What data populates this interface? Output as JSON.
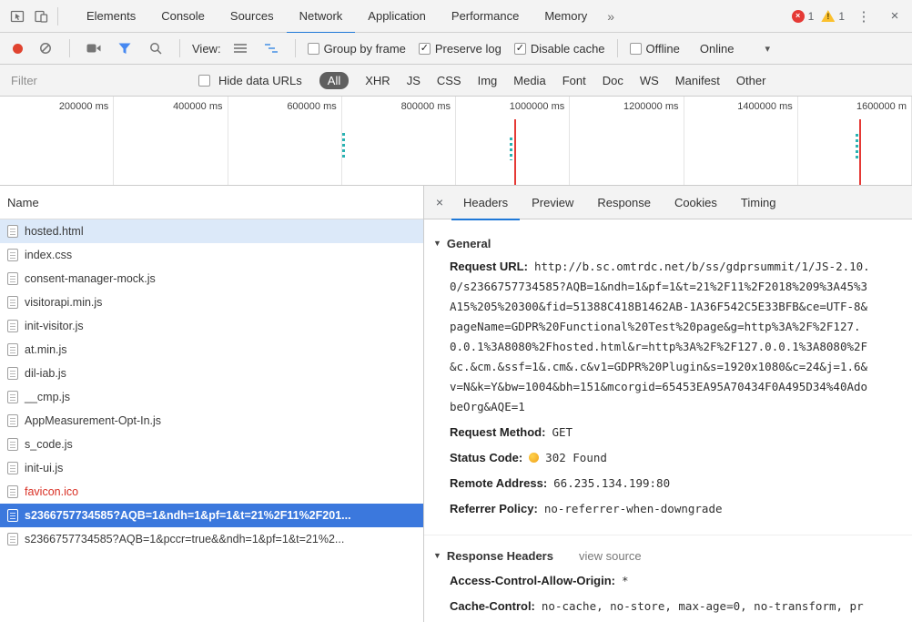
{
  "colors": {
    "tab_underline": "#1e78d7",
    "selection_blue": "#3b78dd",
    "row_highlight": "#dce9f9",
    "error_red": "#d93025",
    "error_badge_red": "#e53935",
    "warning_yellow": "#fbc02d",
    "record_red": "#e0432f",
    "funnel_blue": "#4688f1",
    "status_dot_yellow": "#f0a019",
    "timeline_line_red": "#e53935",
    "timeline_dot_teal": "#2bb3b3",
    "all_pill_bg": "#5f5f5f"
  },
  "icons": {
    "close": "×",
    "overflow_menu": "⋮",
    "more_tabs": "»",
    "dropdown_caret": "▾",
    "section_caret_open": "▼",
    "checkmark": "✓",
    "error_badge": "×",
    "warning_badge": "!"
  },
  "top_bar": {
    "tabs": [
      "Elements",
      "Console",
      "Sources",
      "Network",
      "Application",
      "Performance",
      "Memory"
    ],
    "active_tab": "Network",
    "error_count": "1",
    "warning_count": "1"
  },
  "toolbar": {
    "view_label": "View:",
    "options": [
      {
        "label": "Group by frame",
        "checked": false
      },
      {
        "label": "Preserve log",
        "checked": true
      },
      {
        "label": "Disable cache",
        "checked": true
      },
      {
        "label": "Offline",
        "checked": false
      }
    ],
    "throttling_value": "Online"
  },
  "filter_bar": {
    "filter_placeholder": "Filter",
    "hide_data_urls_label": "Hide data URLs",
    "types": [
      "All",
      "XHR",
      "JS",
      "CSS",
      "Img",
      "Media",
      "Font",
      "Doc",
      "WS",
      "Manifest",
      "Other"
    ],
    "active_type": "All"
  },
  "timeline": {
    "tick_labels": [
      "200000 ms",
      "400000 ms",
      "600000 ms",
      "800000 ms",
      "1000000 ms",
      "1200000 ms",
      "1400000 ms",
      "1600000 m"
    ]
  },
  "request_table": {
    "name_header": "Name",
    "rows": [
      {
        "name": "hosted.html",
        "state": "highlight"
      },
      {
        "name": "index.css",
        "state": "normal"
      },
      {
        "name": "consent-manager-mock.js",
        "state": "normal"
      },
      {
        "name": "visitorapi.min.js",
        "state": "normal"
      },
      {
        "name": "init-visitor.js",
        "state": "normal"
      },
      {
        "name": "at.min.js",
        "state": "normal"
      },
      {
        "name": "dil-iab.js",
        "state": "normal"
      },
      {
        "name": "__cmp.js",
        "state": "normal"
      },
      {
        "name": "AppMeasurement-Opt-In.js",
        "state": "normal"
      },
      {
        "name": "s_code.js",
        "state": "normal"
      },
      {
        "name": "init-ui.js",
        "state": "normal"
      },
      {
        "name": "favicon.ico",
        "state": "error"
      },
      {
        "name": "s2366757734585?AQB=1&ndh=1&pf=1&t=21%2F11%2F201...",
        "state": "selected"
      },
      {
        "name": "s2366757734585?AQB=1&pccr=true&&ndh=1&pf=1&t=21%2...",
        "state": "normal"
      }
    ]
  },
  "details": {
    "tabs": [
      "Headers",
      "Preview",
      "Response",
      "Cookies",
      "Timing"
    ],
    "active_tab": "Headers",
    "general": {
      "title": "General",
      "items": [
        {
          "label": "Request URL:",
          "wrap": true,
          "value": "http://b.sc.omtrdc.net/b/ss/gdprsummit/1/JS-2.10.0/s2366757734585?AQB=1&ndh=1&pf=1&t=21%2F11%2F2018%209%3A45%3A15%205%20300&fid=51388C418B1462AB-1A36F542C5E33BFB&ce=UTF-8&pageName=GDPR%20Functional%20Test%20page&g=http%3A%2F%2F127.0.0.1%3A8080%2Fhosted.html&r=http%3A%2F%2F127.0.0.1%3A8080%2F&c.&cm.&ssf=1&.cm&.c&v1=GDPR%20Plugin&s=1920x1080&c=24&j=1.6&v=N&k=Y&bw=1004&bh=151&mcorgid=65453EA95A70434F0A495D34%40AdobeOrg&AQE=1"
        },
        {
          "label": "Request Method:",
          "value": "GET"
        },
        {
          "label": "Status Code:",
          "value": "302 Found",
          "status": true
        },
        {
          "label": "Remote Address:",
          "value": "66.235.134.199:80"
        },
        {
          "label": "Referrer Policy:",
          "value": "no-referrer-when-downgrade"
        }
      ]
    },
    "response_headers": {
      "title": "Response Headers",
      "view_source_label": "view source",
      "items": [
        {
          "label": "Access-Control-Allow-Origin:",
          "value": "*"
        },
        {
          "label": "Cache-Control:",
          "value": "no-cache, no-store, max-age=0, no-transform, pr"
        }
      ]
    }
  }
}
